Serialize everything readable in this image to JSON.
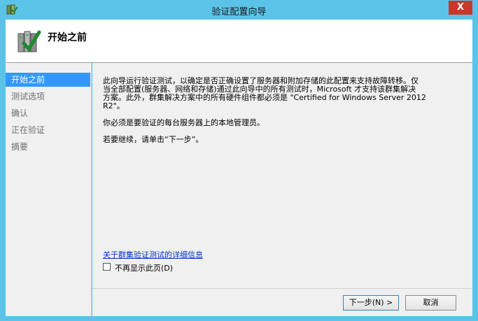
{
  "window": {
    "title": "验证配置向导",
    "close_label": "X"
  },
  "header": {
    "title": "开始之前"
  },
  "sidebar": {
    "items": [
      {
        "label": "开始之前",
        "active": true
      },
      {
        "label": "测试选项",
        "active": false
      },
      {
        "label": "确认",
        "active": false
      },
      {
        "label": "正在验证",
        "active": false
      },
      {
        "label": "摘要",
        "active": false
      }
    ]
  },
  "content": {
    "p1_line1": "此向导运行验证测试，以确定是否正确设置了服务器和附加存储的此配置来支持故障转移。仅",
    "p1_line2": "当全部配置(服务器、网络和存储)通过此向导中的所有测试时，Microsoft 才支持该群集解决",
    "p1_line3": "方案。此外，群集解决方案中的所有硬件组件都必须是 \"Certified for Windows Server 2012",
    "p1_line4": "R2\"。",
    "p2": "你必须是要验证的每台服务器上的本地管理员。",
    "p3": "若要继续，请单击“下一步”。",
    "link": "关于群集验证测试的详细信息",
    "checkbox_label": "不再显示此页(D)",
    "checkbox_checked": false
  },
  "buttons": {
    "next": "下一步(N) >",
    "cancel": "取消"
  },
  "icons": {
    "app": "cluster-app-icon",
    "header": "validation-check-icon"
  },
  "colors": {
    "titlebar": "#5bc3e8",
    "selection": "#3399ff",
    "link": "#0033cc",
    "close": "#c7392b"
  }
}
